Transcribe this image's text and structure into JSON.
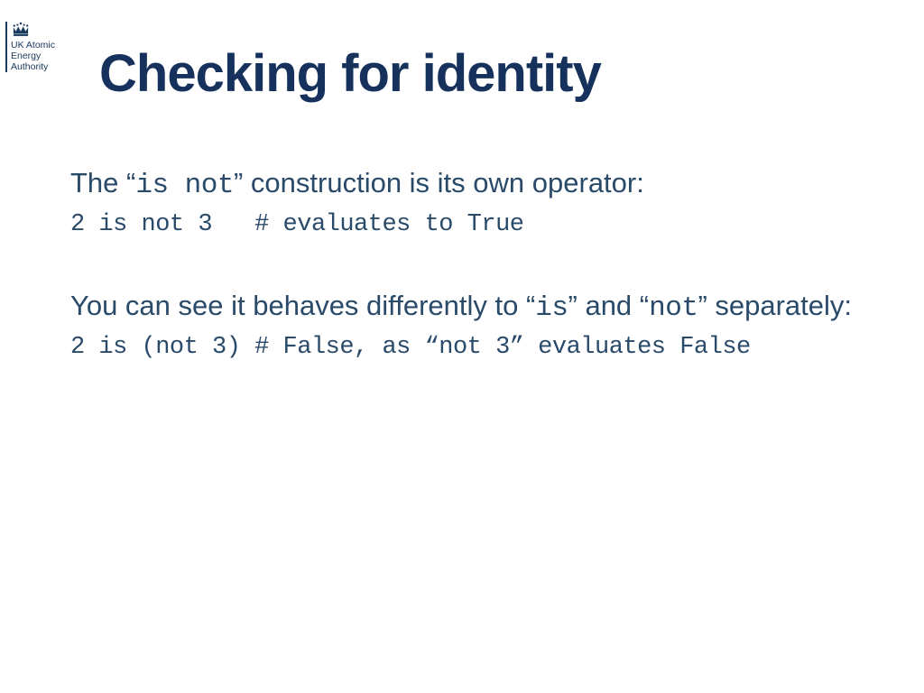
{
  "logo": {
    "line1": "UK Atomic",
    "line2": "Energy",
    "line3": "Authority"
  },
  "title": "Checking for identity",
  "para1": {
    "prefix": "The “",
    "code": "is not",
    "suffix": "”  construction is its own operator:"
  },
  "code1": "2 is not 3   # evaluates to True",
  "para2": {
    "prefix": "You can see it behaves differently to “",
    "code1": "is",
    "mid": "” and “",
    "code2": "not",
    "suffix": "” separately:"
  },
  "code2": "2 is (not 3) # False, as “not 3” evaluates False"
}
